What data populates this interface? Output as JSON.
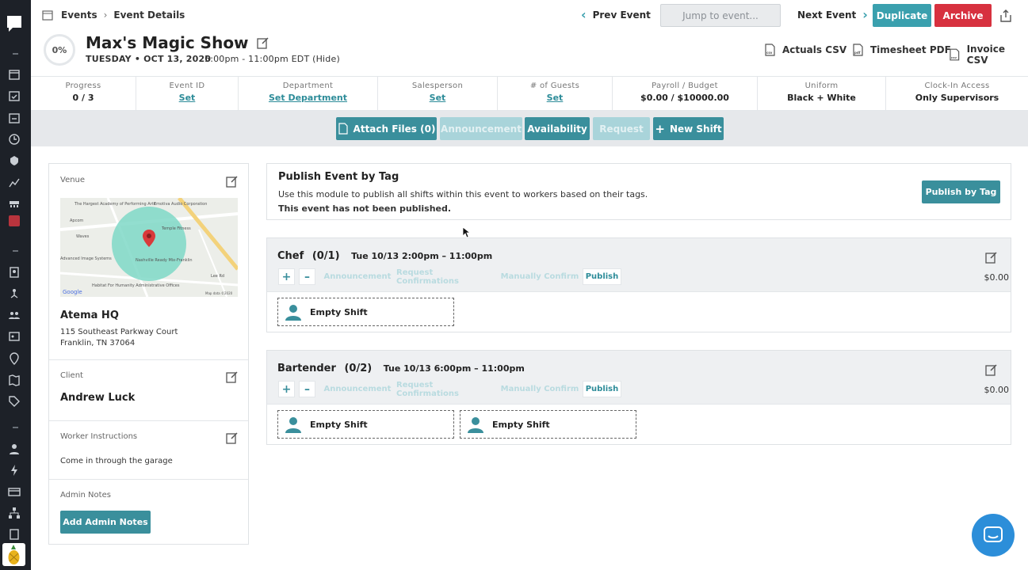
{
  "breadcrumb": {
    "root": "Events",
    "current": "Event Details"
  },
  "nav": {
    "prev_label": "Prev Event",
    "jump_placeholder": "Jump to event...",
    "next_label": "Next Event",
    "duplicate_label": "Duplicate",
    "archive_label": "Archive"
  },
  "event": {
    "progress_pct": "0%",
    "title": "Max's Magic Show",
    "date": "TUESDAY • OCT 13, 2020",
    "time": "5:00pm - 11:00pm EDT (Hide)"
  },
  "exports": [
    "Actuals CSV",
    "Timesheet PDF",
    "Invoice CSV"
  ],
  "stats": [
    {
      "label": "Progress",
      "value": "0 / 3",
      "link": false
    },
    {
      "label": "Event ID",
      "value": "Set",
      "link": true
    },
    {
      "label": "Department",
      "value": "Set Department",
      "link": true
    },
    {
      "label": "Salesperson",
      "value": "Set",
      "link": true
    },
    {
      "label": "# of Guests",
      "value": "Set",
      "link": true
    },
    {
      "label": "Payroll / Budget",
      "value": "$0.00 / $10000.00",
      "link": false
    },
    {
      "label": "Uniform",
      "value": "Black + White",
      "link": false
    },
    {
      "label": "Clock-In Access",
      "value": "Only Supervisors",
      "link": false
    }
  ],
  "actions": {
    "attach": "Attach Files (0)",
    "announcement": "Announcement",
    "availability": "Availability",
    "request": "Request",
    "new_shift": "New Shift"
  },
  "venue": {
    "label": "Venue",
    "name": "Atema HQ",
    "address_line1": "115 Southeast Parkway Court",
    "address_line2": "Franklin, TN 37064",
    "map_labels": {
      "academy": "The Hargest Academy of Performing Arts",
      "audio": "Emotiva Audio Corporation",
      "apcom": "Apcom",
      "waves": "Waves",
      "fitness": "Temple Fitness",
      "nashville": "Nashville Ready Mix-Franklin",
      "advanced": "Advanced Image Systems",
      "habitat": "Habitat For Humanity Administrative Offices",
      "google": "Google",
      "mapdata": "Map data ©2020",
      "lee": "Lee Rd"
    }
  },
  "client": {
    "label": "Client",
    "name": "Andrew Luck"
  },
  "worker_instructions": {
    "label": "Worker Instructions",
    "text": "Come in through the garage"
  },
  "admin_notes": {
    "label": "Admin Notes",
    "button": "Add Admin Notes"
  },
  "publish_by_tag": {
    "heading": "Publish Event by Tag",
    "description": "Use this module to publish all shifts within this event to workers based on their tags.",
    "status": "This event has not been published.",
    "button": "Publish by Tag"
  },
  "roles": [
    {
      "name": "Chef",
      "count": "(0/1)",
      "time": "Tue 10/13 2:00pm – 11:00pm",
      "cost": "$0.00",
      "controls": {
        "plus": "+",
        "minus": "–",
        "announcement": "Announcement",
        "request": "Request Confirmations",
        "manual": "Manually Confirm",
        "publish": "Publish"
      },
      "shifts": [
        "Empty Shift"
      ]
    },
    {
      "name": "Bartender",
      "count": "(0/2)",
      "time": "Tue 10/13 6:00pm – 11:00pm",
      "cost": "$0.00",
      "controls": {
        "plus": "+",
        "minus": "–",
        "announcement": "Announcement",
        "request": "Request Confirmations",
        "manual": "Manually Confirm",
        "publish": "Publish"
      },
      "shifts": [
        "Empty Shift",
        "Empty Shift"
      ]
    }
  ],
  "colors": {
    "accent": "#3a8f9c",
    "danger": "#d7313f",
    "sidebar": "#1d2128",
    "chat": "#2c8ed9"
  }
}
